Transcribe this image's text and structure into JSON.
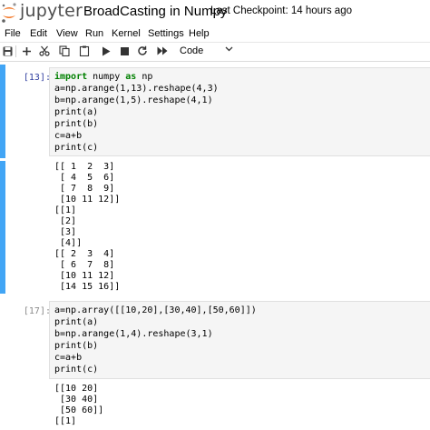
{
  "header": {
    "logo_text": "jupyter",
    "notebook_title": "BroadCasting in Numpy",
    "checkpoint": "Last Checkpoint: 14 hours ago"
  },
  "menu": [
    "File",
    "Edit",
    "View",
    "Run",
    "Kernel",
    "Settings",
    "Help"
  ],
  "toolbar": {
    "buttons": [
      "save-icon",
      "plus-icon",
      "scissors-icon",
      "copy-icon",
      "paste-icon",
      "run-icon",
      "stop-icon",
      "restart-icon",
      "fast-forward-icon"
    ],
    "cell_type": "Code"
  },
  "cells": [
    {
      "prompt": "[13]:",
      "code": [
        {
          "kw": "import",
          "rest": " numpy ",
          "kw2": "as",
          "rest2": " np"
        },
        {
          "text": "a=np.arange(1,13).reshape(4,3)"
        },
        {
          "text": "b=np.arange(1,5).reshape(4,1)"
        },
        {
          "text": "print(a)"
        },
        {
          "text": "print(b)"
        },
        {
          "text": "c=a+b"
        },
        {
          "text": "print(c)"
        }
      ],
      "output": [
        "[[ 1  2  3]",
        " [ 4  5  6]",
        " [ 7  8  9]",
        " [10 11 12]]",
        "[[1]",
        " [2]",
        " [3]",
        " [4]]",
        "[[ 2  3  4]",
        " [ 6  7  8]",
        " [10 11 12]",
        " [14 15 16]]"
      ]
    },
    {
      "prompt": "[17]:",
      "code": [
        {
          "text": "a=np.array([[10,20],[30,40],[50,60]])"
        },
        {
          "text": "print(a)"
        },
        {
          "text": "b=np.arange(1,4).reshape(3,1)"
        },
        {
          "text": "print(b)"
        },
        {
          "text": "c=a+b"
        },
        {
          "text": "print(c)"
        }
      ],
      "output": [
        "[[10 20]",
        " [30 40]",
        " [50 60]]",
        "[[1]"
      ]
    }
  ]
}
